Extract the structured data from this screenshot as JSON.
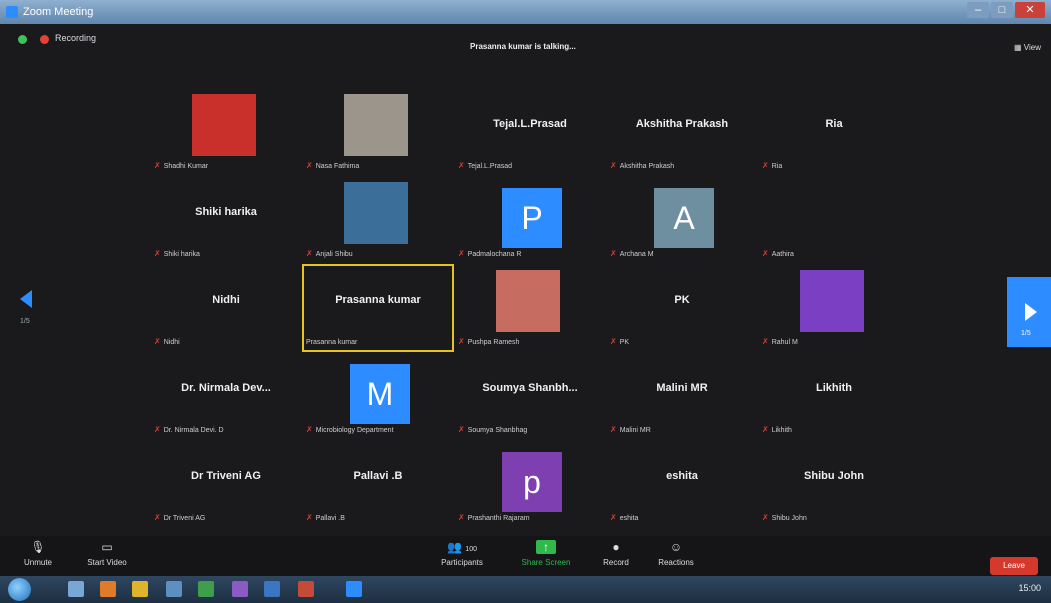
{
  "window": {
    "title": "Zoom Meeting"
  },
  "meeting": {
    "recording_label": "Recording",
    "talking": "Prasanna kumar is talking...",
    "view_label": "View"
  },
  "tiles": [
    {
      "label": "Shadhi Kumar",
      "kind": "photo",
      "photo_color": "#c9302c"
    },
    {
      "label": "Nasa Fathima",
      "kind": "photo",
      "photo_color": "#9b958c"
    },
    {
      "label": "Tejal.L.Prasad",
      "kind": "name",
      "name": "Tejal.L.Prasad"
    },
    {
      "label": "Akshitha Prakash",
      "kind": "name",
      "name": "Akshitha Prakash"
    },
    {
      "label": "Ria",
      "kind": "name",
      "name": "Ria"
    },
    {
      "label": "Shiki harika",
      "kind": "name",
      "name": "Shiki harika"
    },
    {
      "label": "Anjali Shibu",
      "kind": "photo",
      "photo_color": "#3b6f9a"
    },
    {
      "label": "Padmalochana R",
      "kind": "letter",
      "letter": "P",
      "color": "#2d8cff"
    },
    {
      "label": "Archana M",
      "kind": "letter",
      "letter": "A",
      "color": "#6e8fa0"
    },
    {
      "label": "Aathira",
      "kind": "blank"
    },
    {
      "label": "Nidhi",
      "kind": "name",
      "name": "Nidhi"
    },
    {
      "label": "Prasanna kumar",
      "kind": "name",
      "name": "Prasanna kumar",
      "active": true
    },
    {
      "label": "Pushpa Ramesh",
      "kind": "photo",
      "photo_color": "#c76c60"
    },
    {
      "label": "PK",
      "kind": "name",
      "name": "PK"
    },
    {
      "label": "Rahul M",
      "kind": "photo",
      "photo_color": "#7b3fc4"
    },
    {
      "label": "Dr. Nirmala Devi. D",
      "kind": "name",
      "name": "Dr. Nirmala Dev..."
    },
    {
      "label": "Microbiology Department",
      "kind": "letter",
      "letter": "M",
      "color": "#2d8cff"
    },
    {
      "label": "Soumya Shanbhag",
      "kind": "name",
      "name": "Soumya Shanbh..."
    },
    {
      "label": "Malini MR",
      "kind": "name",
      "name": "Malini MR"
    },
    {
      "label": "Likhith",
      "kind": "name",
      "name": "Likhith"
    },
    {
      "label": "Dr Triveni AG",
      "kind": "name",
      "name": "Dr Triveni AG"
    },
    {
      "label": "Pallavi .B",
      "kind": "name",
      "name": "Pallavi .B"
    },
    {
      "label": "Prashanthi Rajaram",
      "kind": "letter",
      "letter": "p",
      "color": "#7e3fb0"
    },
    {
      "label": "eshita",
      "kind": "name",
      "name": "eshita"
    },
    {
      "label": "Shibu John",
      "kind": "name",
      "name": "Shibu John"
    }
  ],
  "nav": {
    "left_page": "1/5",
    "right_page": "1/5"
  },
  "toolbar": {
    "unmute": "Unmute",
    "start_video": "Start Video",
    "participants": "Participants",
    "participants_count": "100",
    "share_screen": "Share Screen",
    "record": "Record",
    "reactions": "Reactions",
    "leave": "Leave"
  },
  "taskbar": {
    "clock": "15:00"
  }
}
